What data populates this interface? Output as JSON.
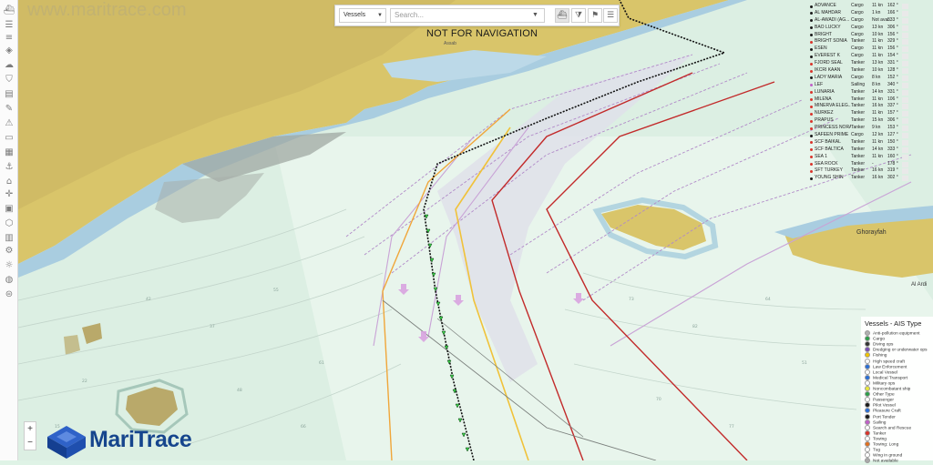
{
  "watermark": "www.maritrace.com",
  "toolbar": {
    "vessel_select": "Vessels",
    "search_placeholder": "Search..."
  },
  "banner": "NOT FOR NAVIGATION",
  "places": {
    "assab": "Assab",
    "ghorayfah": "Ghorayfah",
    "al_ardi": "Al Ardi"
  },
  "vessels": [
    {
      "name": "ADVANCE",
      "type": "Cargo",
      "speed": "11 kn",
      "heading": "162 °",
      "color": "#1a1a1a"
    },
    {
      "name": "AL MAHDAR",
      "type": "Cargo",
      "speed": "1 kn",
      "heading": "166 °",
      "color": "#1a1a1a"
    },
    {
      "name": "AL-AWADI (AG...",
      "type": "Cargo",
      "speed": "Not avai...",
      "heading": "333 °",
      "color": "#1a1a1a"
    },
    {
      "name": "BAO LUCKY",
      "type": "Cargo",
      "speed": "13 kn",
      "heading": "306 °",
      "color": "#1a1a1a"
    },
    {
      "name": "BRIGHT",
      "type": "Cargo",
      "speed": "10 kn",
      "heading": "156 °",
      "color": "#1a1a1a"
    },
    {
      "name": "BRIGHT SONIA",
      "type": "Tanker",
      "speed": "11 kn",
      "heading": "329 °",
      "color": "#d9342b"
    },
    {
      "name": "ESEN",
      "type": "Cargo",
      "speed": "11 kn",
      "heading": "156 °",
      "color": "#1a1a1a"
    },
    {
      "name": "EVEREST K",
      "type": "Cargo",
      "speed": "11 kn",
      "heading": "154 °",
      "color": "#1a1a1a"
    },
    {
      "name": "FJORD SEAL",
      "type": "Tanker",
      "speed": "13 kn",
      "heading": "331 °",
      "color": "#d9342b"
    },
    {
      "name": "IKCRI KAAN",
      "type": "Tanker",
      "speed": "10 kn",
      "heading": "128 °",
      "color": "#d9342b"
    },
    {
      "name": "LADY MARIA",
      "type": "Cargo",
      "speed": "8 kn",
      "heading": "152 °",
      "color": "#1a1a1a"
    },
    {
      "name": "LEF",
      "type": "Sailing",
      "speed": "8 kn",
      "heading": "340 °",
      "color": "#c060c8"
    },
    {
      "name": "LUNARIA",
      "type": "Tanker",
      "speed": "14 kn",
      "heading": "331 °",
      "color": "#d9342b"
    },
    {
      "name": "MILENA",
      "type": "Tanker",
      "speed": "11 kn",
      "heading": "106 °",
      "color": "#d9342b"
    },
    {
      "name": "MINERVA ELEG...",
      "type": "Tanker",
      "speed": "16 kn",
      "heading": "337 °",
      "color": "#d9342b"
    },
    {
      "name": "NURKEZ",
      "type": "Tanker",
      "speed": "11 kn",
      "heading": "157 °",
      "color": "#d9342b"
    },
    {
      "name": "PRAPUS",
      "type": "Tanker",
      "speed": "15 kn",
      "heading": "306 °",
      "color": "#d9342b"
    },
    {
      "name": "PRINCESS NORA",
      "type": "Tanker",
      "speed": "9 kn",
      "heading": "153 °",
      "color": "#d9342b"
    },
    {
      "name": "SAFEEN PRIME",
      "type": "Cargo",
      "speed": "12 kn",
      "heading": "127 °",
      "color": "#1a1a1a"
    },
    {
      "name": "SCF BAIKAL",
      "type": "Tanker",
      "speed": "11 kn",
      "heading": "150 °",
      "color": "#d9342b"
    },
    {
      "name": "SCF BALTICA",
      "type": "Tanker",
      "speed": "14 kn",
      "heading": "333 °",
      "color": "#d9342b"
    },
    {
      "name": "SEA 1",
      "type": "Tanker",
      "speed": "11 kn",
      "heading": "160 °",
      "color": "#d9342b"
    },
    {
      "name": "SEA ROCK",
      "type": "Tanker",
      "speed": "-",
      "heading": "178 °",
      "color": "#d9342b"
    },
    {
      "name": "SFT TURKEY",
      "type": "Tanker",
      "speed": "16 kn",
      "heading": "319 °",
      "color": "#d9342b"
    },
    {
      "name": "YOUNG SHIN",
      "type": "Tanker",
      "speed": "16 kn",
      "heading": "302 °",
      "color": "#1a1a1a"
    }
  ],
  "legend": {
    "title": "Vessels - AIS Type",
    "items": [
      {
        "label": "Anti-pollution equipment",
        "color": "#b0b0b0"
      },
      {
        "label": "Cargo",
        "color": "#2e9e4a"
      },
      {
        "label": "Diving ops",
        "color": "#333333"
      },
      {
        "label": "Dredging or underwater ops",
        "color": "#7a4fb5"
      },
      {
        "label": "Fishing",
        "color": "#f0c400"
      },
      {
        "label": "High speed craft",
        "color": "#ffffff"
      },
      {
        "label": "Law Enforcement",
        "color": "#2a6fd6"
      },
      {
        "label": "Local Vessel",
        "color": "#ffffff"
      },
      {
        "label": "Medical Transport",
        "color": "#2a6fd6"
      },
      {
        "label": "Military ops",
        "color": "#ffffff"
      },
      {
        "label": "Noncombatant ship",
        "color": "#e8e83a"
      },
      {
        "label": "Other Type",
        "color": "#2e9e4a"
      },
      {
        "label": "Passenger",
        "color": "#ffffff"
      },
      {
        "label": "Pilot Vessel",
        "color": "#1a1a1a"
      },
      {
        "label": "Pleasure Craft",
        "color": "#2a6fd6"
      },
      {
        "label": "Port Tender",
        "color": "#1a1a1a"
      },
      {
        "label": "Sailing",
        "color": "#c060c8"
      },
      {
        "label": "Search and Rescue",
        "color": "#ffffff"
      },
      {
        "label": "Tanker",
        "color": "#d9342b"
      },
      {
        "label": "Towing",
        "color": "#ffffff"
      },
      {
        "label": "Towing: Long",
        "color": "#e07020"
      },
      {
        "label": "Tug",
        "color": "#ffffff"
      },
      {
        "label": "Wing in ground",
        "color": "#ffffff"
      },
      {
        "label": "Not available",
        "color": "#aaaaaa"
      }
    ]
  },
  "zoom": {
    "in": "+",
    "out": "−"
  },
  "logo": "MariTrace"
}
